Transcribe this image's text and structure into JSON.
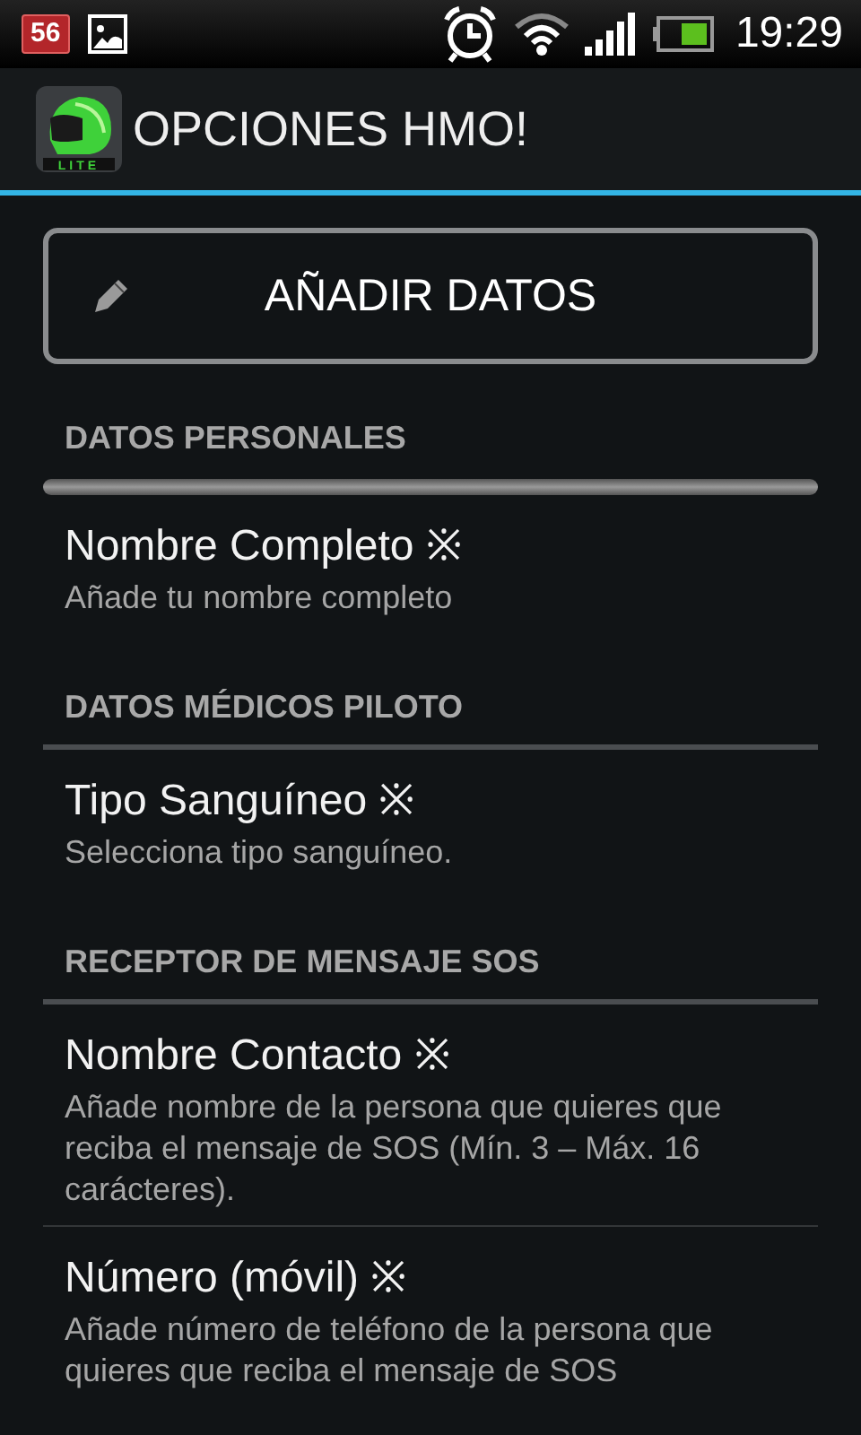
{
  "status_bar": {
    "notification_count": "56",
    "time": "19:29"
  },
  "action_bar": {
    "title": "OPCIONES HMO!",
    "logo_label": "LITE"
  },
  "add_button": {
    "label": "AÑADIR DATOS"
  },
  "sections": [
    {
      "header": "DATOS PERSONALES",
      "items": [
        {
          "title": "Nombre Completo ※",
          "summary": "Añade tu nombre completo"
        }
      ]
    },
    {
      "header": "DATOS MÉDICOS PILOTO",
      "items": [
        {
          "title": "Tipo Sanguíneo ※",
          "summary": "Selecciona tipo sanguíneo."
        }
      ]
    },
    {
      "header": "RECEPTOR DE MENSAJE SOS",
      "items": [
        {
          "title": "Nombre Contacto ※",
          "summary": "Añade nombre de la persona que quieres que reciba el mensaje de SOS (Mín. 3 – Máx. 16 carácteres)."
        },
        {
          "title": "Número (móvil) ※",
          "summary": "Añade número de teléfono de la persona que quieres que reciba el mensaje de SOS"
        }
      ]
    }
  ]
}
